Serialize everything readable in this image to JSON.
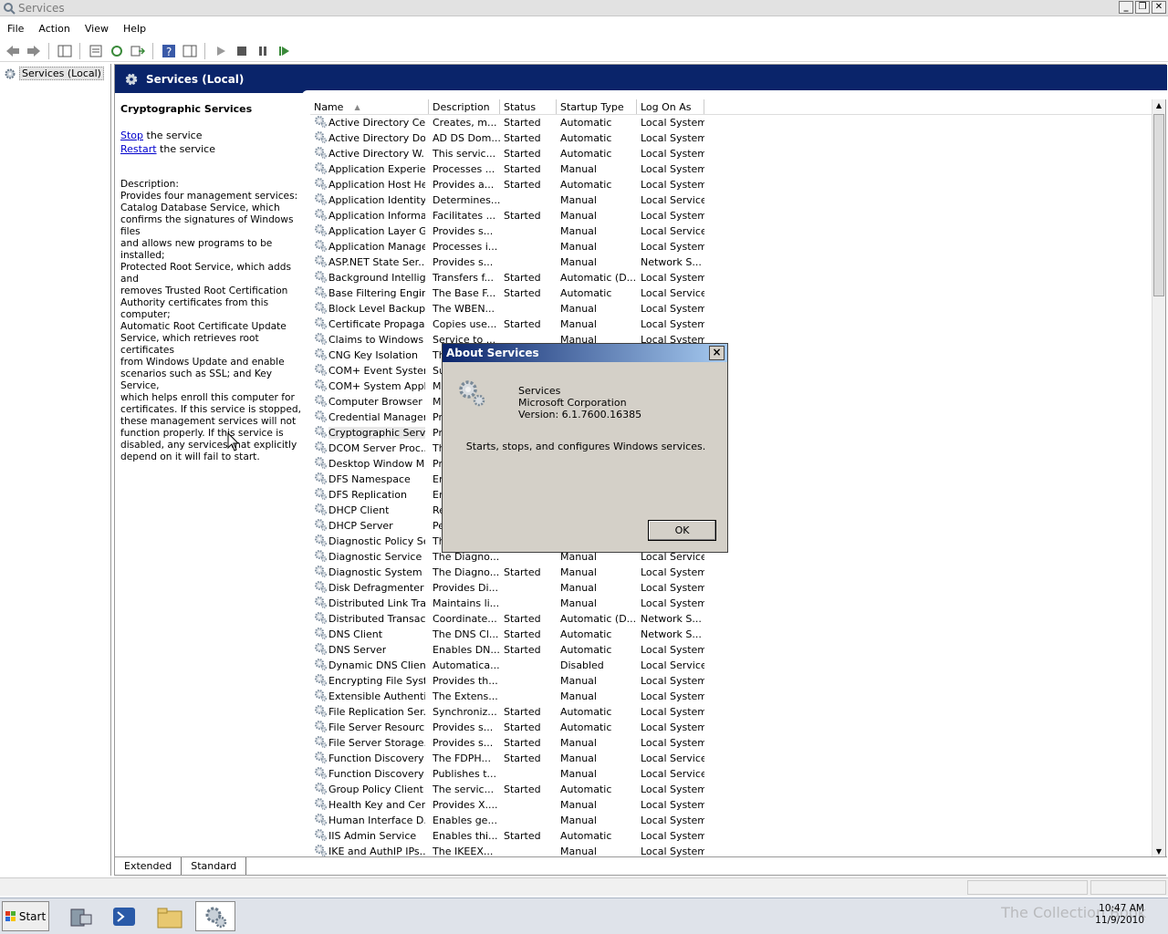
{
  "window": {
    "title": "Services"
  },
  "menu": [
    "File",
    "Action",
    "View",
    "Help"
  ],
  "tree": {
    "label": "Services (Local)"
  },
  "header": {
    "label": "Services (Local)"
  },
  "extended": {
    "service_title": "Cryptographic Services",
    "stop_link": "Stop",
    "stop_rest": " the service",
    "restart_link": "Restart",
    "restart_rest": " the service",
    "desc_label": "Description:",
    "desc_lines": [
      "Provides four management services:",
      "Catalog Database Service, which",
      "confirms the signatures of Windows files",
      "and allows new programs to be installed;",
      "Protected Root Service, which adds and",
      "removes Trusted Root Certification",
      "Authority certificates from this computer;",
      "Automatic Root Certificate Update",
      "Service, which retrieves root certificates",
      "from Windows Update and enable",
      "scenarios such as SSL; and Key Service,",
      "which helps enroll this computer for",
      "certificates. If this service is stopped,",
      "these management services will not",
      "function properly. If this service is",
      "disabled, any services that explicitly",
      "depend on it will fail to start."
    ]
  },
  "columns": [
    "Name",
    "Description",
    "Status",
    "Startup Type",
    "Log On As"
  ],
  "services": [
    [
      "Active Directory Ce...",
      "Creates, m...",
      "Started",
      "Automatic",
      "Local System"
    ],
    [
      "Active Directory Do...",
      "AD DS Dom...",
      "Started",
      "Automatic",
      "Local System"
    ],
    [
      "Active Directory W...",
      "This servic...",
      "Started",
      "Automatic",
      "Local System"
    ],
    [
      "Application Experie...",
      "Processes ...",
      "Started",
      "Manual",
      "Local System"
    ],
    [
      "Application Host He...",
      "Provides a...",
      "Started",
      "Automatic",
      "Local System"
    ],
    [
      "Application Identity",
      "Determines...",
      "",
      "Manual",
      "Local Service"
    ],
    [
      "Application Informa...",
      "Facilitates ...",
      "Started",
      "Manual",
      "Local System"
    ],
    [
      "Application Layer G...",
      "Provides s...",
      "",
      "Manual",
      "Local Service"
    ],
    [
      "Application Manage...",
      "Processes i...",
      "",
      "Manual",
      "Local System"
    ],
    [
      "ASP.NET State Ser...",
      "Provides s...",
      "",
      "Manual",
      "Network S..."
    ],
    [
      "Background Intellig...",
      "Transfers f...",
      "Started",
      "Automatic (D...",
      "Local System"
    ],
    [
      "Base Filtering Engine",
      "The Base F...",
      "Started",
      "Automatic",
      "Local Service"
    ],
    [
      "Block Level Backup ...",
      "The WBEN...",
      "",
      "Manual",
      "Local System"
    ],
    [
      "Certificate Propaga...",
      "Copies use...",
      "Started",
      "Manual",
      "Local System"
    ],
    [
      "Claims to Windows ...",
      "Service to ...",
      "",
      "Manual",
      "Local System"
    ],
    [
      "CNG Key Isolation",
      "Th",
      "",
      "",
      ""
    ],
    [
      "COM+ Event System",
      "Su",
      "",
      "",
      ""
    ],
    [
      "COM+ System Appl...",
      "M",
      "",
      "",
      ""
    ],
    [
      "Computer Browser",
      "M",
      "",
      "",
      ""
    ],
    [
      "Credential Manager",
      "Pr",
      "",
      "",
      ""
    ],
    [
      "Cryptographic Serv...",
      "Pr",
      "",
      "",
      ""
    ],
    [
      "DCOM Server Proc...",
      "Th",
      "",
      "",
      ""
    ],
    [
      "Desktop Window M...",
      "Pr",
      "",
      "",
      ""
    ],
    [
      "DFS Namespace",
      "Er",
      "",
      "",
      ""
    ],
    [
      "DFS Replication",
      "Er",
      "",
      "",
      ""
    ],
    [
      "DHCP Client",
      "Re",
      "",
      "",
      ""
    ],
    [
      "DHCP Server",
      "Pe",
      "",
      "",
      ""
    ],
    [
      "Diagnostic Policy Se...",
      "Th",
      "",
      "",
      ""
    ],
    [
      "Diagnostic Service ...",
      "The Diagno...",
      "",
      "Manual",
      "Local Service"
    ],
    [
      "Diagnostic System ...",
      "The Diagno...",
      "Started",
      "Manual",
      "Local System"
    ],
    [
      "Disk Defragmenter",
      "Provides Di...",
      "",
      "Manual",
      "Local System"
    ],
    [
      "Distributed Link Tra...",
      "Maintains li...",
      "",
      "Manual",
      "Local System"
    ],
    [
      "Distributed Transac...",
      "Coordinate...",
      "Started",
      "Automatic (D...",
      "Network S..."
    ],
    [
      "DNS Client",
      "The DNS Cl...",
      "Started",
      "Automatic",
      "Network S..."
    ],
    [
      "DNS Server",
      "Enables DN...",
      "Started",
      "Automatic",
      "Local System"
    ],
    [
      "Dynamic DNS Client",
      "Automatica...",
      "",
      "Disabled",
      "Local Service"
    ],
    [
      "Encrypting File Syst...",
      "Provides th...",
      "",
      "Manual",
      "Local System"
    ],
    [
      "Extensible Authenti...",
      "The Extens...",
      "",
      "Manual",
      "Local System"
    ],
    [
      "File Replication Ser...",
      "Synchroniz...",
      "Started",
      "Automatic",
      "Local System"
    ],
    [
      "File Server Resourc...",
      "Provides s...",
      "Started",
      "Automatic",
      "Local System"
    ],
    [
      "File Server Storage...",
      "Provides s...",
      "Started",
      "Manual",
      "Local System"
    ],
    [
      "Function Discovery ...",
      "The FDPH...",
      "Started",
      "Manual",
      "Local Service"
    ],
    [
      "Function Discovery ...",
      "Publishes t...",
      "",
      "Manual",
      "Local Service"
    ],
    [
      "Group Policy Client",
      "The servic...",
      "Started",
      "Automatic",
      "Local System"
    ],
    [
      "Health Key and Cer...",
      "Provides X....",
      "",
      "Manual",
      "Local System"
    ],
    [
      "Human Interface D...",
      "Enables ge...",
      "",
      "Manual",
      "Local System"
    ],
    [
      "IIS Admin Service",
      "Enables thi...",
      "Started",
      "Automatic",
      "Local System"
    ],
    [
      "IKE and AuthIP IPs...",
      "The IKEEX...",
      "",
      "Manual",
      "Local System"
    ]
  ],
  "selected_index": 20,
  "tabs": [
    "Extended",
    "Standard"
  ],
  "dialog": {
    "title": "About Services",
    "product": "Services",
    "company": "Microsoft Corporation",
    "version": "Version: 6.1.7600.16385",
    "body": "Starts, stops, and configures Windows services.",
    "ok": "OK",
    "close": "×"
  },
  "taskbar": {
    "start": "Start",
    "time": "10:47 AM",
    "date": "11/9/2010",
    "watermark": "The Collection Book"
  },
  "colors": {
    "header": "#0a246a",
    "link": "#0000cc",
    "dialog_bg": "#d4d0c8"
  },
  "icons": [
    "services-gear-icon",
    "back-icon",
    "forward-icon",
    "play-icon",
    "stop-icon",
    "pause-icon",
    "restart-icon"
  ]
}
